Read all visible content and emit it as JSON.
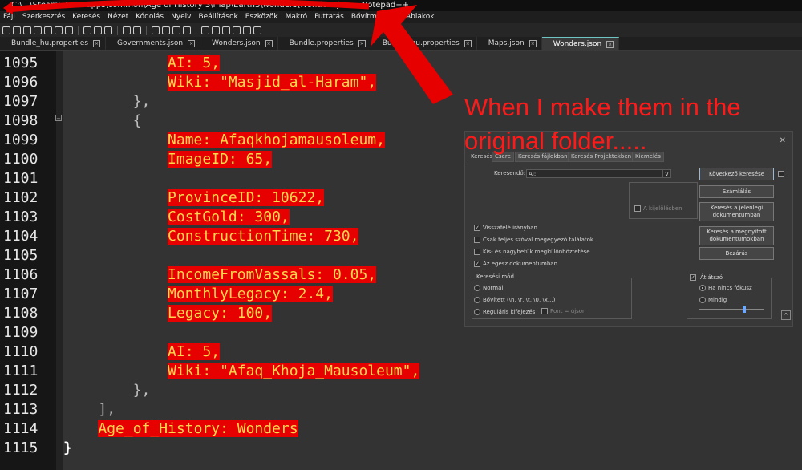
{
  "window": {
    "title": "C:\\...\\Steam\\steamapps\\common\\Age of History 3\\map\\Earth3\\wonders\\Wonders.json - Notepad++"
  },
  "menu": [
    "Fájl",
    "Szerkesztés",
    "Keresés",
    "Nézet",
    "Kódolás",
    "Nyelv",
    "Beállítások",
    "Eszközök",
    "Makró",
    "Futtatás",
    "Bővítmények",
    "Ablakok"
  ],
  "tabs": [
    {
      "label": "Bundle_hu.properties",
      "active": false
    },
    {
      "label": "Governments.json",
      "active": false
    },
    {
      "label": "Wonders.json",
      "active": false
    },
    {
      "label": "Bundle.properties",
      "active": false
    },
    {
      "label": "Bundle_hu.properties",
      "active": false
    },
    {
      "label": "Maps.json",
      "active": false
    },
    {
      "label": "Wonders.json",
      "active": true
    }
  ],
  "editor": {
    "lines": [
      {
        "num": "1095",
        "indent": "            ",
        "text": "AI: 5,",
        "hl": true
      },
      {
        "num": "1096",
        "indent": "            ",
        "text": "Wiki: \"Masjid_al-Haram\",",
        "hl": true
      },
      {
        "num": "1097",
        "indent": "        ",
        "text": "},",
        "hl": false
      },
      {
        "num": "1098",
        "indent": "        ",
        "text": "{",
        "hl": false
      },
      {
        "num": "1099",
        "indent": "            ",
        "text": "Name: Afaqkhojamausoleum,",
        "hl": true
      },
      {
        "num": "1100",
        "indent": "            ",
        "text": "ImageID: 65,",
        "hl": true
      },
      {
        "num": "1101",
        "indent": "",
        "text": "",
        "hl": false
      },
      {
        "num": "1102",
        "indent": "            ",
        "text": "ProvinceID: 10622,",
        "hl": true
      },
      {
        "num": "1103",
        "indent": "            ",
        "text": "CostGold: 300,",
        "hl": true
      },
      {
        "num": "1104",
        "indent": "            ",
        "text": "ConstructionTime: 730,",
        "hl": true
      },
      {
        "num": "1105",
        "indent": "",
        "text": "",
        "hl": false
      },
      {
        "num": "1106",
        "indent": "            ",
        "text": "IncomeFromVassals: 0.05,",
        "hl": true
      },
      {
        "num": "1107",
        "indent": "            ",
        "text": "MonthlyLegacy: 2.4,",
        "hl": true
      },
      {
        "num": "1108",
        "indent": "            ",
        "text": "Legacy: 100,",
        "hl": true
      },
      {
        "num": "1109",
        "indent": "",
        "text": "",
        "hl": false
      },
      {
        "num": "1110",
        "indent": "            ",
        "text": "AI: 5,",
        "hl": true
      },
      {
        "num": "1111",
        "indent": "            ",
        "text": "Wiki: \"Afaq_Khoja_Mausoleum\",",
        "hl": true
      },
      {
        "num": "1112",
        "indent": "        ",
        "text": "},",
        "hl": false
      },
      {
        "num": "1113",
        "indent": "    ",
        "text": "],",
        "hl": false
      },
      {
        "num": "1114",
        "indent": "    ",
        "text": "Age_of_History: Wonders",
        "hl": true
      },
      {
        "num": "1115",
        "indent": "",
        "text": "}",
        "hl": false,
        "brace": true
      }
    ]
  },
  "annotation": {
    "text": "When I make them in the original folder....."
  },
  "dialog": {
    "tabs": [
      "Keresés",
      "Csere",
      "Keresés fájlokban",
      "Keresés Projektekben",
      "Kiemelés"
    ],
    "search_label": "Keresendő:",
    "search_value": "AI:",
    "buttons": {
      "find_next": "Következő keresése",
      "count": "Számlálás",
      "find_all_current": "Keresés a jelenlegi dokumentumban",
      "find_all_open": "Keresés a megnyitott dokumentumokban",
      "close": "Bezárás"
    },
    "in_selection": "A kijelölésben",
    "options": [
      {
        "label": "Visszafelé irányban",
        "checked": true
      },
      {
        "label": "Csak teljes szóval megegyező találatok",
        "checked": false
      },
      {
        "label": "Kis- és nagybetűk megkülönböztetése",
        "checked": false
      },
      {
        "label": "Az egész dokumentumban",
        "checked": true
      }
    ],
    "mode_title": "Keresési mód",
    "modes": [
      {
        "label": "Normál",
        "checked": false
      },
      {
        "label": "Bővített (\\n, \\r, \\t, \\0, \\x...)",
        "checked": false
      },
      {
        "label": "Reguláris kifejezés",
        "checked": false
      }
    ],
    "dot_newline": "Pont = újsor",
    "transparency_title": "Átlátszó",
    "transparency": [
      {
        "label": "Ha nincs fókusz",
        "checked": true
      },
      {
        "label": "Mindig",
        "checked": false
      }
    ]
  }
}
